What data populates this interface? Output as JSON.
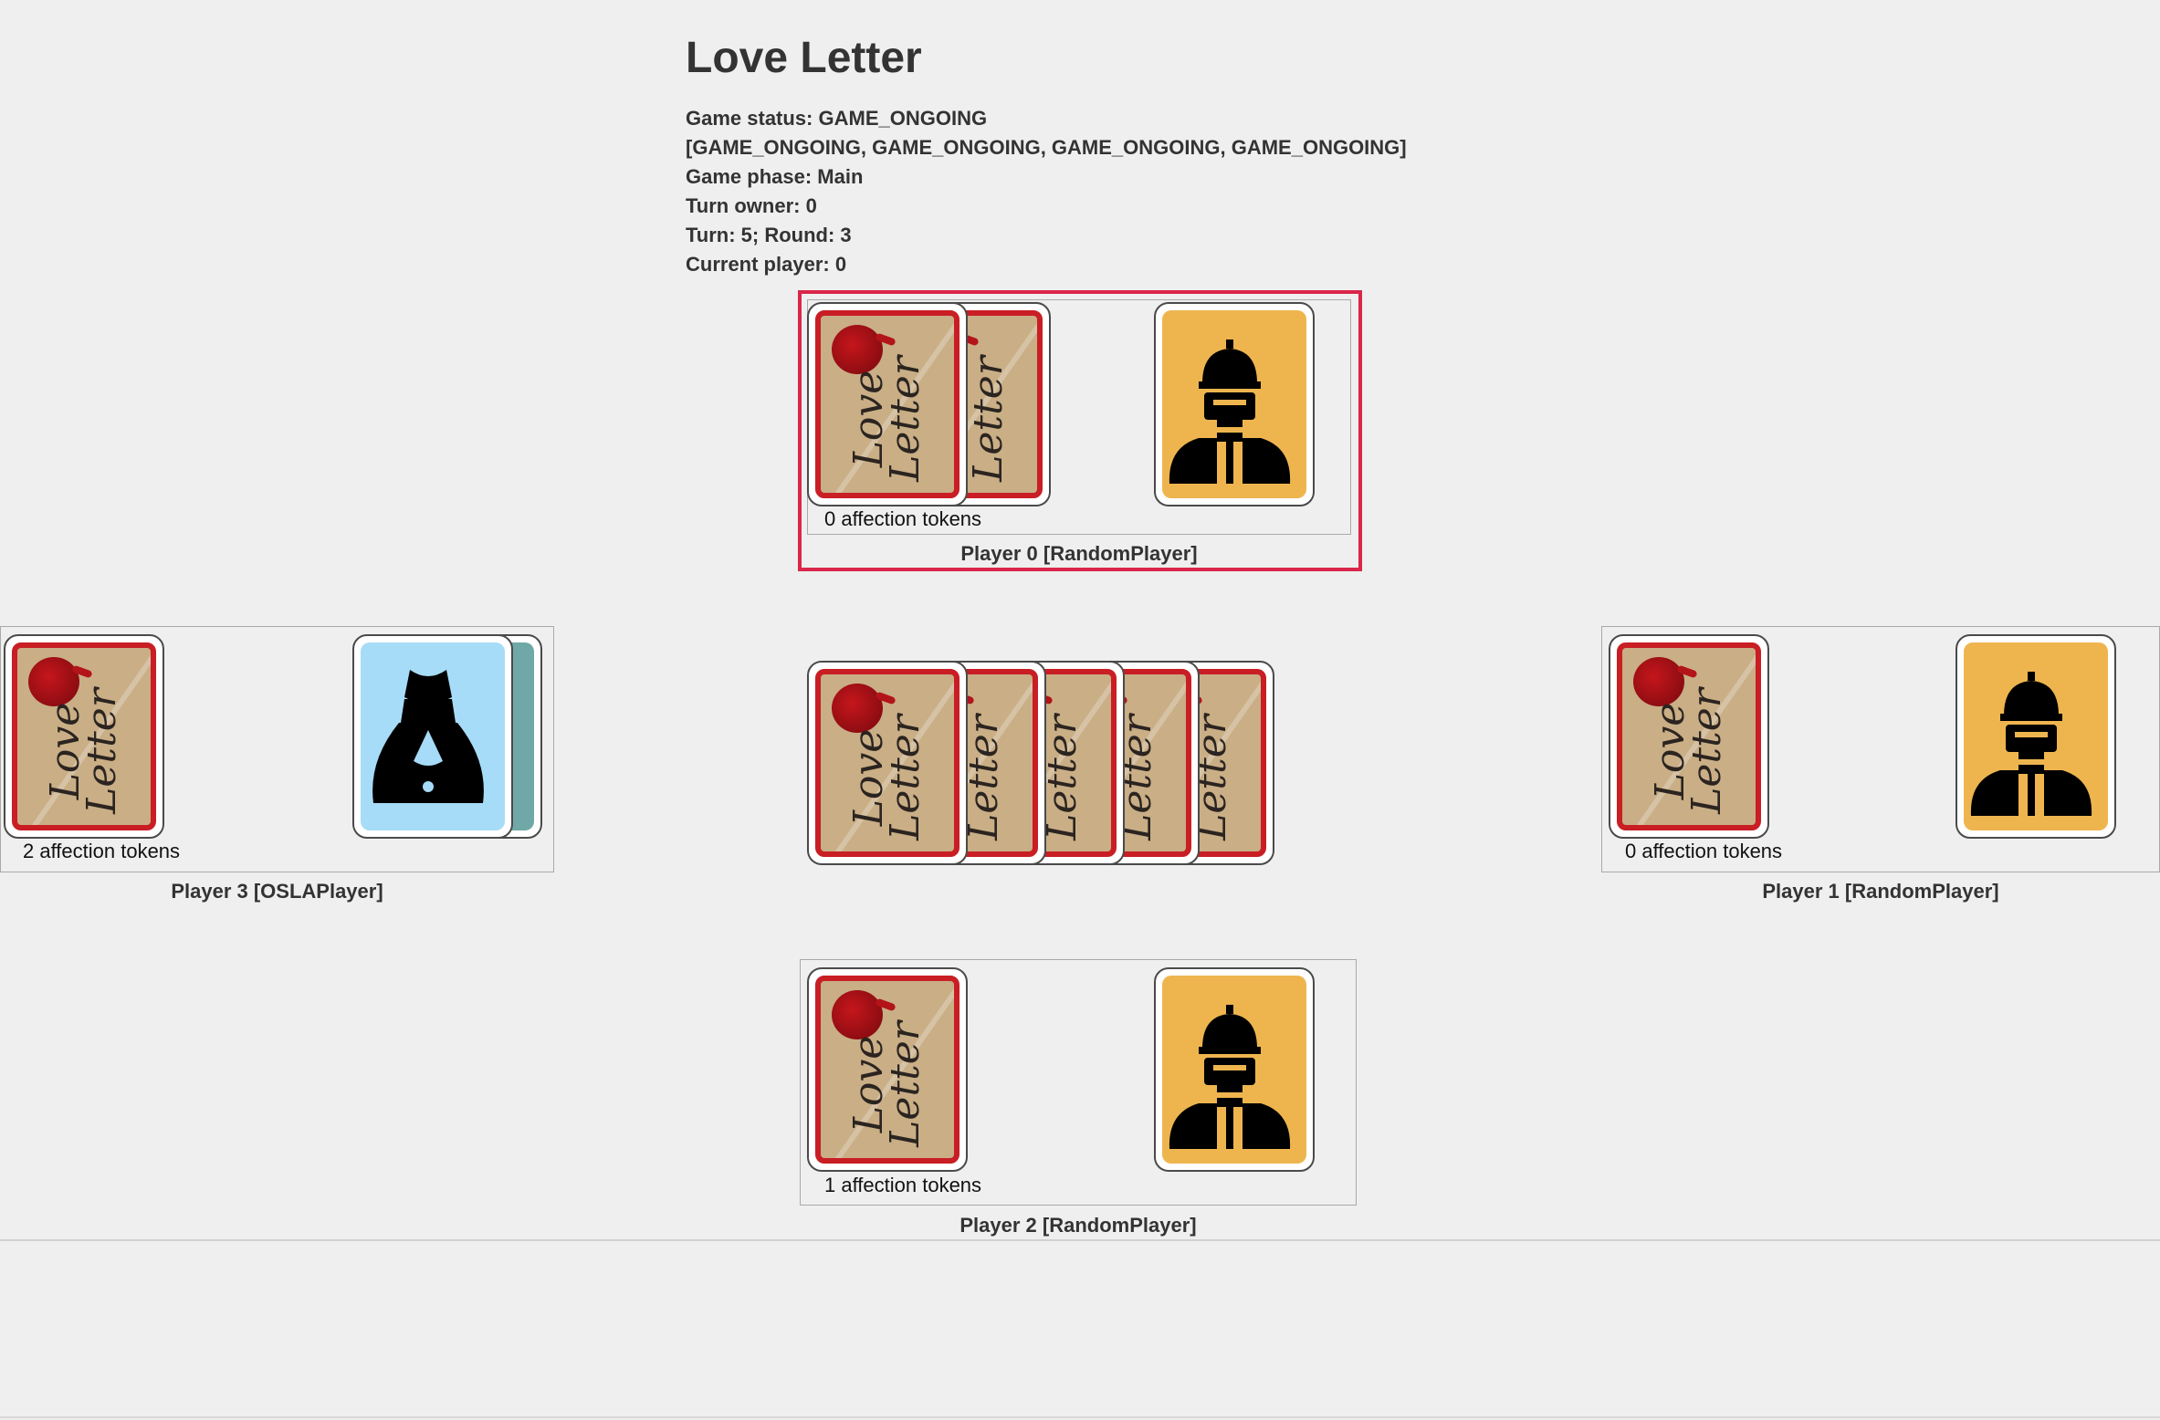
{
  "game": {
    "title": "Love Letter",
    "status_line": "Game status: GAME_ONGOING",
    "player_status_line": "[GAME_ONGOING, GAME_ONGOING, GAME_ONGOING, GAME_ONGOING]",
    "phase_line": "Game phase: Main",
    "turn_owner_line": "Turn owner: 0",
    "turn_round_line": "Turn: 5; Round: 3",
    "current_player_line": "Current player: 0"
  },
  "card_back_text": "Love Letter",
  "players": {
    "p0": {
      "label": "Player 0 [RandomPlayer]",
      "tokens": "0 affection tokens",
      "active": true,
      "played_card": "guard-icon"
    },
    "p1": {
      "label": "Player 1 [RandomPlayer]",
      "tokens": "0 affection tokens",
      "played_card": "guard-icon"
    },
    "p2": {
      "label": "Player 2 [RandomPlayer]",
      "tokens": "1 affection tokens",
      "played_card": "guard-icon"
    },
    "p3": {
      "label": "Player 3 [OSLAPlayer]",
      "tokens": "2 affection tokens",
      "played_card": "princess-dress-icon"
    }
  },
  "colors": {
    "active_highlight": "#d9264a",
    "card_back_border": "#c81e24",
    "guard_card": "#eeb54f",
    "princess_card": "#a6dcf7"
  }
}
